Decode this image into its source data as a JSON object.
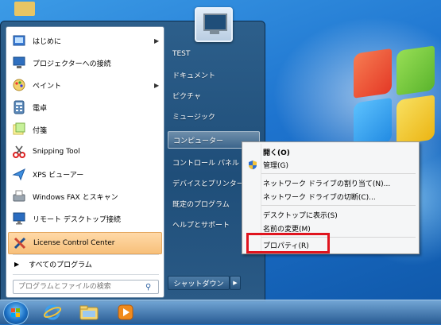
{
  "start_menu": {
    "programs": [
      {
        "label": "はじめに",
        "icon": "getting-started-icon",
        "submenu": true
      },
      {
        "label": "プロジェクターへの接続",
        "icon": "projector-icon",
        "submenu": false
      },
      {
        "label": "ペイント",
        "icon": "paint-icon",
        "submenu": true
      },
      {
        "label": "電卓",
        "icon": "calculator-icon",
        "submenu": false
      },
      {
        "label": "付箋",
        "icon": "sticky-notes-icon",
        "submenu": false
      },
      {
        "label": "Snipping Tool",
        "icon": "scissors-icon",
        "submenu": false
      },
      {
        "label": "XPS ビューアー",
        "icon": "xps-viewer-icon",
        "submenu": false
      },
      {
        "label": "Windows FAX とスキャン",
        "icon": "fax-icon",
        "submenu": false
      },
      {
        "label": "リモート デスクトップ接続",
        "icon": "remote-desktop-icon",
        "submenu": false
      },
      {
        "label": "License Control Center",
        "icon": "license-tools-icon",
        "submenu": false,
        "selected": true
      }
    ],
    "all_programs": "すべてのプログラム",
    "search_placeholder": "プログラムとファイルの検索",
    "right_items": [
      {
        "label": "TEST"
      },
      {
        "label": "ドキュメント"
      },
      {
        "label": "ピクチャ"
      },
      {
        "label": "ミュージック"
      },
      {
        "label": "コンピューター",
        "highlighted": true
      },
      {
        "label": "コントロール パネル"
      },
      {
        "label": "デバイスとプリンター"
      },
      {
        "label": "既定のプログラム"
      },
      {
        "label": "ヘルプとサポート"
      }
    ],
    "shutdown_label": "シャットダウン"
  },
  "context_menu": {
    "items": [
      {
        "label": "開く(O)",
        "bold": true
      },
      {
        "label": "管理(G)",
        "icon": "shield-icon"
      },
      {
        "label": "ネットワーク ドライブの割り当て(N)..."
      },
      {
        "label": "ネットワーク ドライブの切断(C)..."
      },
      {
        "label": "デスクトップに表示(S)"
      },
      {
        "label": "名前の変更(M)"
      },
      {
        "label": "プロパティ(R)",
        "highlighted": true
      }
    ]
  },
  "colors": {
    "highlight_border": "#e0141e",
    "selected_program": "#f7c07a"
  },
  "taskbar": {
    "items": [
      "start-orb-icon",
      "internet-explorer-icon",
      "folder-icon",
      "media-player-icon"
    ]
  }
}
